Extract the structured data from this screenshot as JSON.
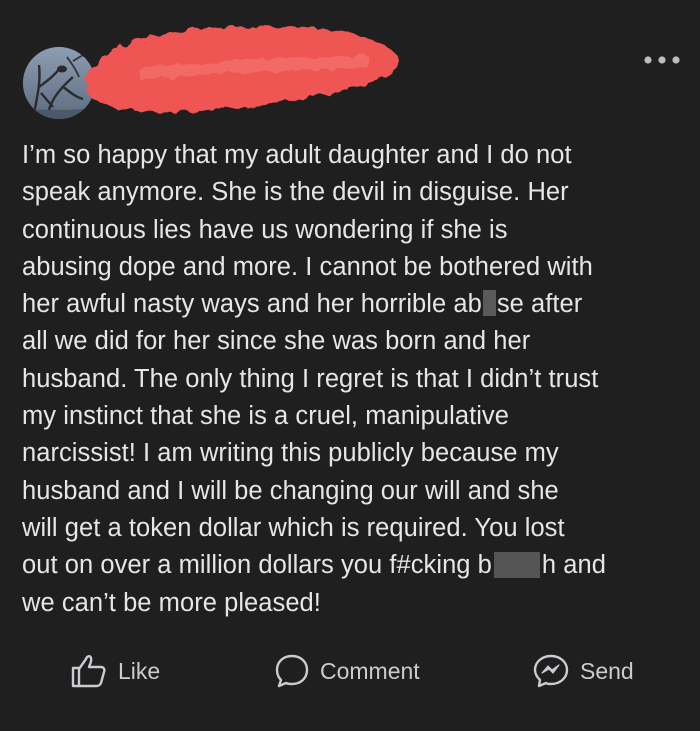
{
  "post": {
    "text_lines": [
      "I’m so happy that my adult daughter and I do not",
      "speak anymore. She is the devil in disguise. Her",
      "continuous lies have us wondering if she is",
      "abusing dope and more. I cannot be bothered with",
      "her awful nasty ways and her horrible ab",
      "all we did for her since she was born and her",
      "husband. The only thing I regret is that I didn’t trust",
      "my instinct that she is a cruel, manipulative",
      "narcissist! I am writing this publicly because my",
      "husband and I will be changing our will and she",
      "will get a token dollar which is required. You lost",
      "out on over a million dollars you f#cking b",
      "we can’t be more pleased!"
    ],
    "line5_after_censor": "se after",
    "line12_after_censor": "h and"
  },
  "actions": {
    "like_label": "Like",
    "comment_label": "Comment",
    "send_label": "Send"
  },
  "icons": {
    "like": "thumbs-up-icon",
    "comment": "comment-bubble-icon",
    "send": "messenger-icon",
    "more": "more-options-icon"
  },
  "colors": {
    "background": "#1f1f1f",
    "text": "#e6e6e6",
    "action_text": "#c9ccd1",
    "redaction": "#f0524f"
  }
}
